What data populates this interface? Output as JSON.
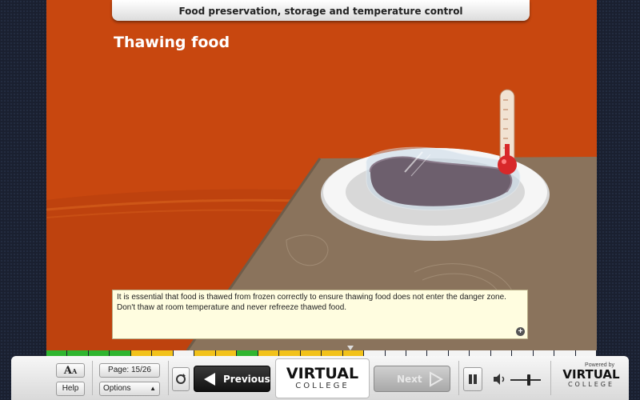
{
  "header": {
    "course_title": "Food preservation, storage and temperature control"
  },
  "slide": {
    "heading": "Thawing food",
    "caption": "It is essential that food is thawed from frozen correctly to ensure thawing food does not enter the danger zone. Don't thaw at room temperature and never refreeze thawed food.",
    "expand_symbol": "+"
  },
  "progress": {
    "segments": [
      "green",
      "green",
      "green",
      "green",
      "yellow",
      "yellow",
      "white",
      "yellow",
      "yellow",
      "green",
      "yellow",
      "yellow",
      "yellow",
      "yellow",
      "yellow",
      "white",
      "white",
      "white",
      "white",
      "white",
      "white",
      "white",
      "white",
      "white",
      "white",
      "white"
    ],
    "colors": {
      "green": "#2fb52f",
      "yellow": "#f2c21a",
      "white": "#f4f4f4"
    }
  },
  "controls": {
    "font_size_label_big": "A",
    "font_size_label_small": "A",
    "help_label": "Help",
    "page_label": "Page: 15/26",
    "options_label": "Options",
    "options_arrow": "▲",
    "previous_label": "Previous",
    "next_label": "Next",
    "logo_virtual": "VIRTUAL",
    "logo_college": "COLLEGE",
    "powered_by": "Powered by",
    "volume_level": 0.6
  }
}
